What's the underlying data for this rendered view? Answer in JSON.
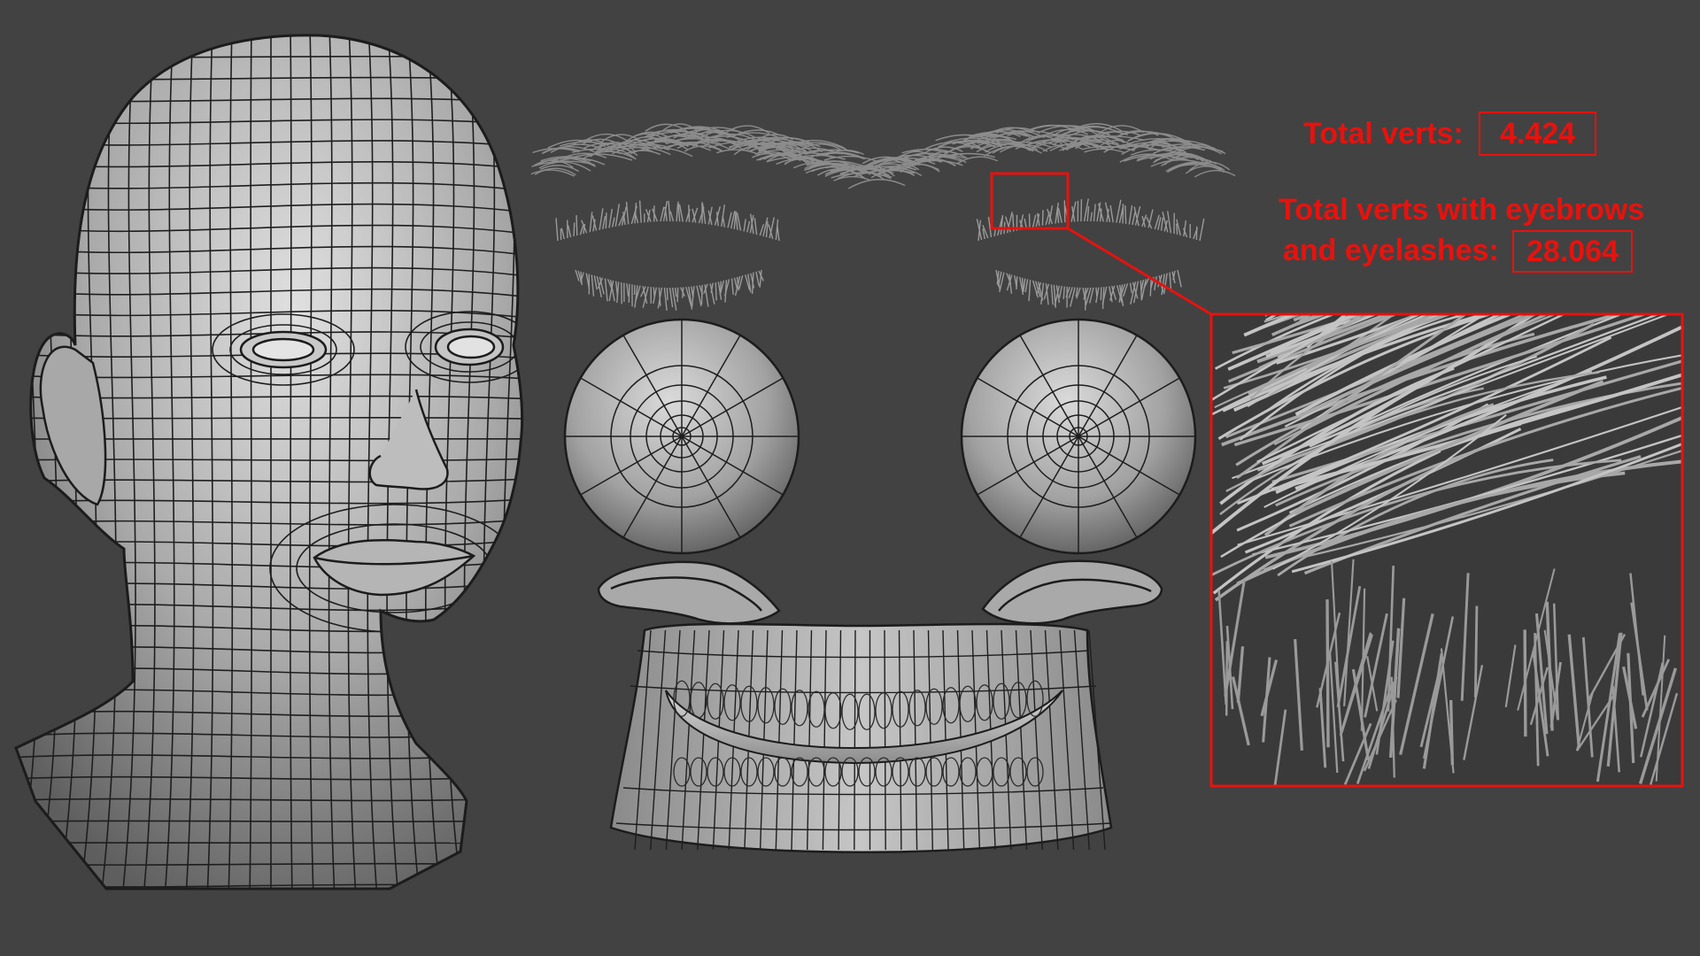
{
  "stats": {
    "total_verts_label": "Total verts:",
    "total_verts_value": "4.424",
    "total_verts_with_extras_label_line1": "Total verts with eyebrows",
    "total_verts_with_extras_label_line2": "and eyelashes:",
    "total_verts_with_extras_value": "28.064"
  },
  "colors": {
    "background": "#424242",
    "mesh_fill": "#b9b9b9",
    "wire": "#1c1c1c",
    "annotation_red": "#e8120e"
  },
  "parts": [
    "head-mesh",
    "eyebrows",
    "eyelashes",
    "eyeballs",
    "tear-lines",
    "teeth-gums",
    "zoom-inset"
  ]
}
